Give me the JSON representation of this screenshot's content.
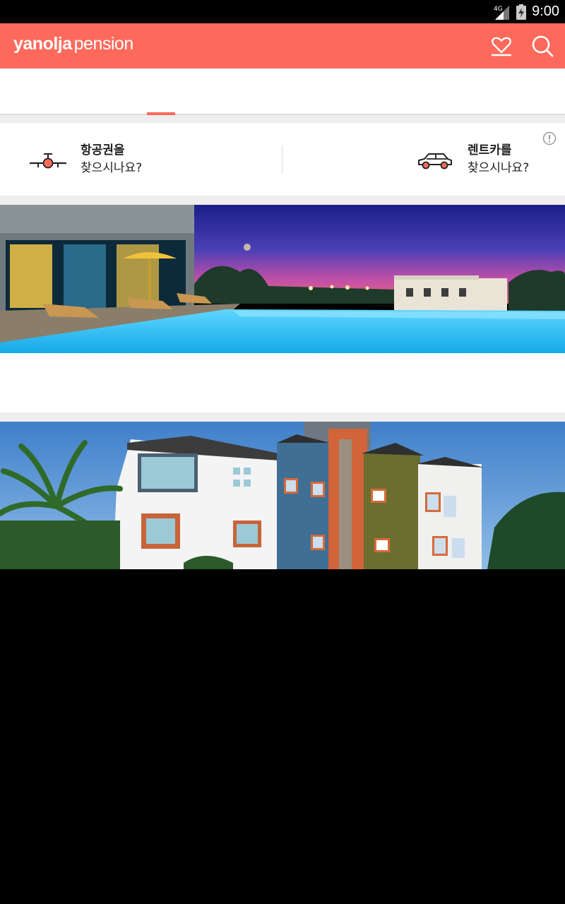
{
  "status_bar": {
    "network": "4G",
    "time": "9:00"
  },
  "app_bar": {
    "brand": "yanolja",
    "product": "pension",
    "icons": [
      "heart-icon",
      "search-icon"
    ],
    "color": "#fd6a5b"
  },
  "quick_links": [
    {
      "line1": "항공권을",
      "line2": "찾으시나요?",
      "icon": "airplane-icon"
    },
    {
      "line1": "렌트카를",
      "line2": "찾으시나요?",
      "icon": "car-icon"
    }
  ],
  "banners": [
    {
      "name": "pool-resort-banner"
    },
    {
      "name": "pension-building-banner"
    }
  ]
}
